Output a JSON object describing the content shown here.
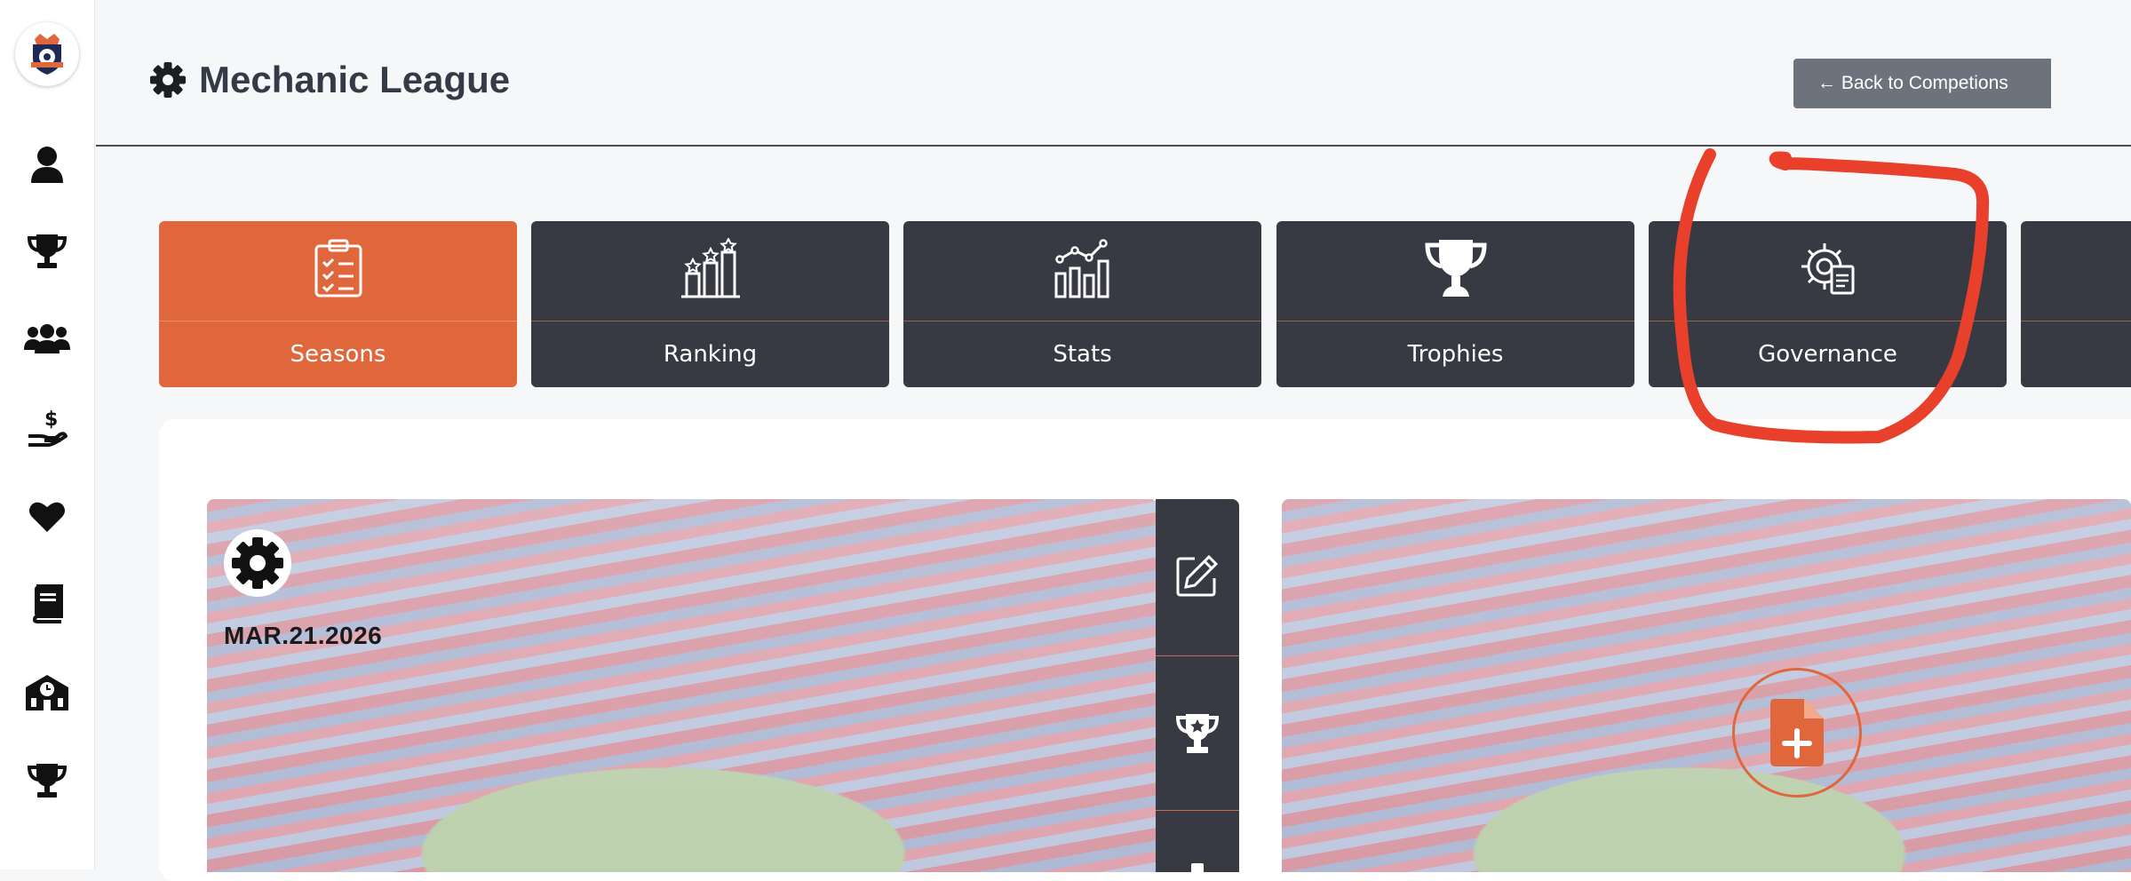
{
  "header": {
    "title": "Mechanic League",
    "back_button_label": "← Back to Competions"
  },
  "sidebar": {
    "items": [
      {
        "icon": "user-icon"
      },
      {
        "icon": "trophy-icon"
      },
      {
        "icon": "users-icon"
      },
      {
        "icon": "hand-dollar-icon"
      },
      {
        "icon": "heart-icon"
      },
      {
        "icon": "book-icon"
      },
      {
        "icon": "school-icon"
      },
      {
        "icon": "trophy-icon"
      }
    ]
  },
  "tabs": [
    {
      "label": "Seasons",
      "icon": "clipboard-checklist-icon",
      "active": true
    },
    {
      "label": "Ranking",
      "icon": "ranking-podium-icon",
      "active": false
    },
    {
      "label": "Stats",
      "icon": "stats-chart-icon",
      "active": false
    },
    {
      "label": "Trophies",
      "icon": "trophy-icon",
      "active": false
    },
    {
      "label": "Governance",
      "icon": "gear-document-icon",
      "active": false
    }
  ],
  "seasons": [
    {
      "date": "MAR.21.2026",
      "icon": "gear-icon"
    }
  ],
  "actions": [
    {
      "icon": "edit-icon"
    },
    {
      "icon": "trophy-star-icon"
    }
  ],
  "add_season": {
    "icon": "file-plus-icon"
  },
  "colors": {
    "accent": "#e0663b",
    "tab_bg": "#383a43",
    "title": "#343a46",
    "annotation": "#e8402a"
  }
}
